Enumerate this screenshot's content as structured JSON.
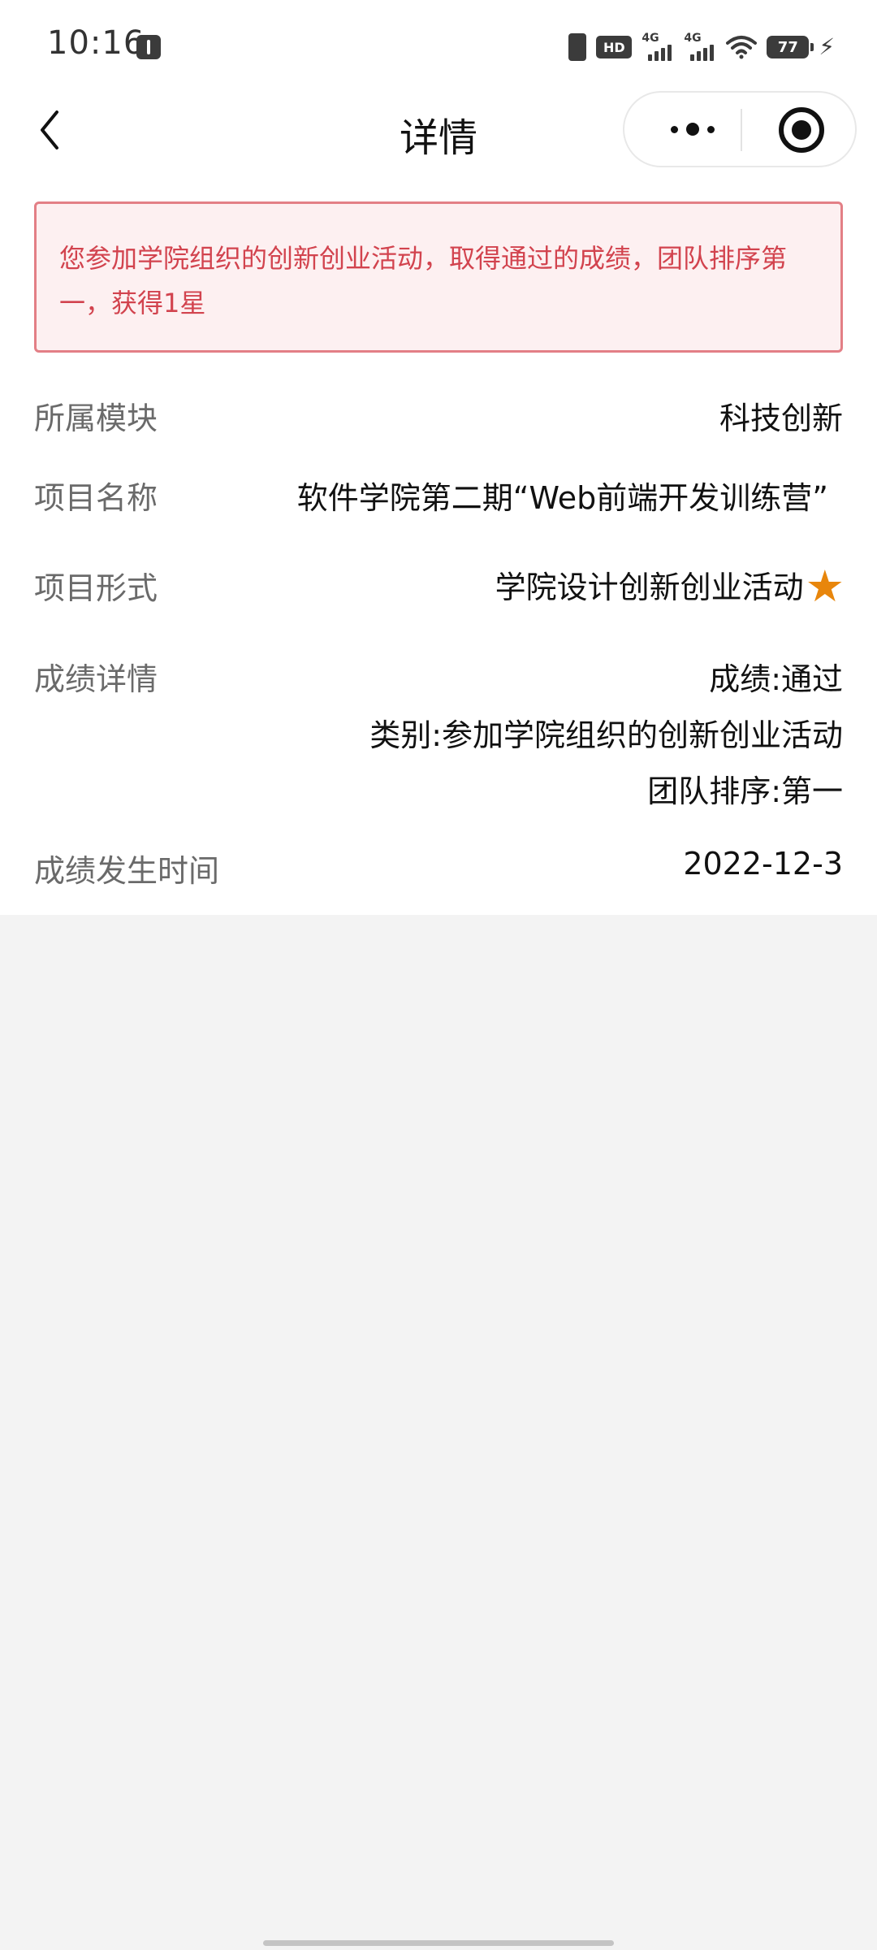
{
  "status_bar": {
    "time": "10:16",
    "hd_label": "HD",
    "signal1_label": "4G",
    "signal2_label": "4G",
    "battery_level": "77"
  },
  "nav": {
    "title": "详情"
  },
  "notice": {
    "text": "您参加学院组织的创新创业活动，取得通过的成绩，团队排序第一，获得1星"
  },
  "details": {
    "module": {
      "label": "所属模块",
      "value": "科技创新"
    },
    "project_name": {
      "label": "项目名称",
      "value": "软件学院第二期“Web前端开发训练营”"
    },
    "project_form": {
      "label": "项目形式",
      "value": "学院设计创新创业活动",
      "stars": 1
    },
    "score_detail": {
      "label": "成绩详情",
      "lines": [
        "成绩:通过",
        "类别:参加学院组织的创新创业活动",
        "团队排序:第一"
      ]
    },
    "score_time": {
      "label": "成绩发生时间",
      "value": "2022-12-3"
    }
  },
  "colors": {
    "notice_text": "#d2434e",
    "notice_border": "#e37f86",
    "notice_bg": "#fdf0f1",
    "star": "#e8860c",
    "page_bg": "#f3f3f3"
  }
}
